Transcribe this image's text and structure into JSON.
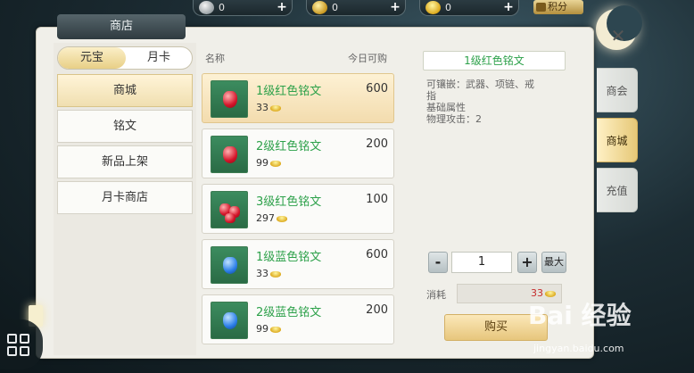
{
  "topbar": {
    "silver": {
      "value": "0",
      "icon": "silver-coin-icon"
    },
    "copper": {
      "value": "0",
      "icon": "copper-coin-icon"
    },
    "gold": {
      "value": "0",
      "icon": "gold-ingot-icon"
    },
    "points_label": "积分"
  },
  "shop": {
    "title": "商店",
    "currency_tabs": [
      "元宝",
      "月卡"
    ],
    "nav": [
      "商城",
      "铭文",
      "新品上架",
      "月卡商店"
    ],
    "list_headers": {
      "name": "名称",
      "daily": "今日可购"
    },
    "items": [
      {
        "name": "1级红色铭文",
        "price": "33",
        "qty": "600",
        "gem": "red"
      },
      {
        "name": "2级红色铭文",
        "price": "99",
        "qty": "200",
        "gem": "red"
      },
      {
        "name": "3级红色铭文",
        "price": "297",
        "qty": "100",
        "gem": "red-multi"
      },
      {
        "name": "1级蓝色铭文",
        "price": "33",
        "qty": "600",
        "gem": "blue"
      },
      {
        "name": "2级蓝色铭文",
        "price": "99",
        "qty": "200",
        "gem": "blue"
      }
    ],
    "detail": {
      "title": "1级红色铭文",
      "inlay_line1": "可镶嵌：武器、项链、戒",
      "inlay_line2": "指",
      "attr_header": "基础属性",
      "attr": "物理攻击：2",
      "minus": "-",
      "quantity": "1",
      "plus": "+",
      "max": "最大",
      "cost_label": "消耗",
      "cost_value": "33",
      "buy": "购买"
    }
  },
  "side_tabs": [
    "商会",
    "商城",
    "充值"
  ],
  "close": "✕",
  "watermark": {
    "main": "Bai 经验",
    "sub": "jingyan.baidu.com"
  }
}
